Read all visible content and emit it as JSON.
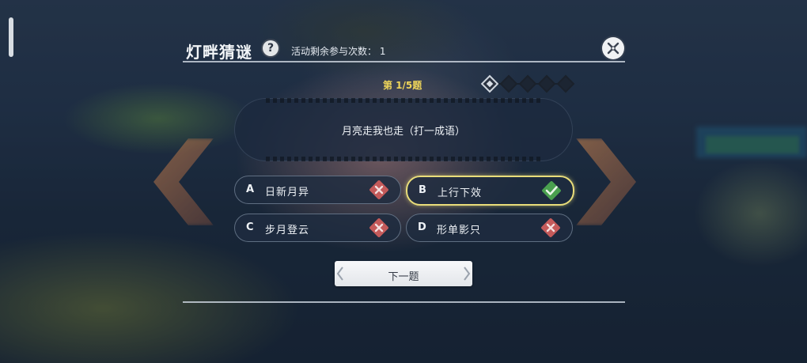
{
  "header": {
    "title": "灯畔猜谜",
    "help_glyph": "?",
    "remaining_label": "活动剩余参与次数：",
    "remaining_count": "1"
  },
  "progress": {
    "label": "第 1/5题",
    "current": 1,
    "total": 5
  },
  "question": {
    "text": "月亮走我也走（打一成语）"
  },
  "options": [
    {
      "letter": "A",
      "text": "日新月异",
      "status": "wrong"
    },
    {
      "letter": "B",
      "text": "上行下效",
      "status": "correct"
    },
    {
      "letter": "C",
      "text": "步月登云",
      "status": "wrong"
    },
    {
      "letter": "D",
      "text": "形单影只",
      "status": "wrong"
    }
  ],
  "next_button": {
    "label": "下一题"
  },
  "colors": {
    "accent_gold": "#f0d65a",
    "correct_green": "#4aa04f",
    "wrong_red": "#c45a5a"
  }
}
